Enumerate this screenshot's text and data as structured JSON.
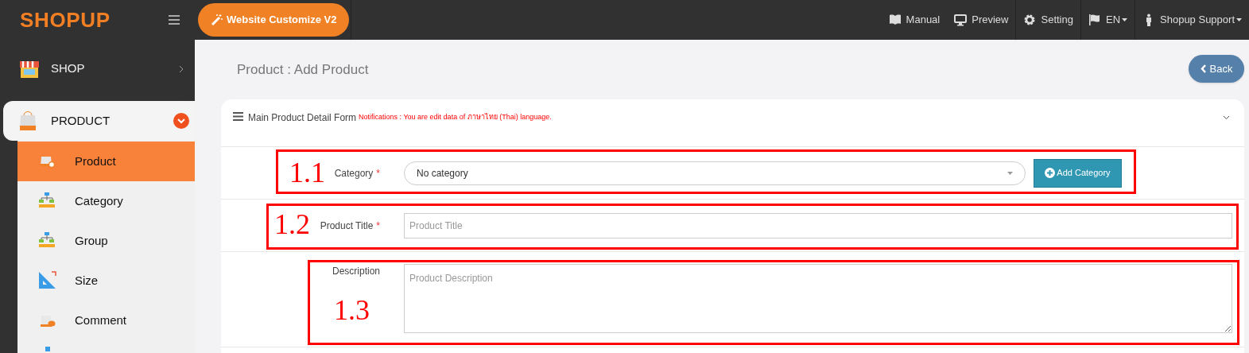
{
  "header": {
    "logo": "SHOPUP",
    "customize_button": "Website Customize V2",
    "nav": [
      {
        "label": "Manual",
        "dropdown": false
      },
      {
        "label": "Preview",
        "dropdown": false
      },
      {
        "label": "Setting",
        "dropdown": false
      },
      {
        "label": "EN",
        "dropdown": true
      },
      {
        "label": "Shopup Support",
        "dropdown": true
      }
    ]
  },
  "sidebar": {
    "sections": [
      {
        "label": "SHOP",
        "expanded": false
      },
      {
        "label": "PRODUCT",
        "expanded": true,
        "children": [
          {
            "label": "Product",
            "selected": true
          },
          {
            "label": "Category",
            "selected": false
          },
          {
            "label": "Group",
            "selected": false
          },
          {
            "label": "Size",
            "selected": false
          },
          {
            "label": "Comment",
            "selected": false
          }
        ]
      }
    ]
  },
  "page_title": "Product : Add Product",
  "back_button": "Back",
  "form": {
    "title": "Main Product Detail Form",
    "notice": "Notifications : You are edit data of ภาษาไทย (Thai) language.",
    "fields": [
      {
        "kind": "select",
        "label": "Category",
        "required_mark": "*",
        "value": "No category",
        "button": "Add Category",
        "annotation": "1.1"
      },
      {
        "kind": "text",
        "label": "Product Title",
        "required_mark": "*",
        "placeholder": "Product Title",
        "annotation": "1.2"
      },
      {
        "kind": "textarea",
        "label": "Description",
        "placeholder": "Product Description",
        "annotation": "1.3"
      }
    ]
  }
}
